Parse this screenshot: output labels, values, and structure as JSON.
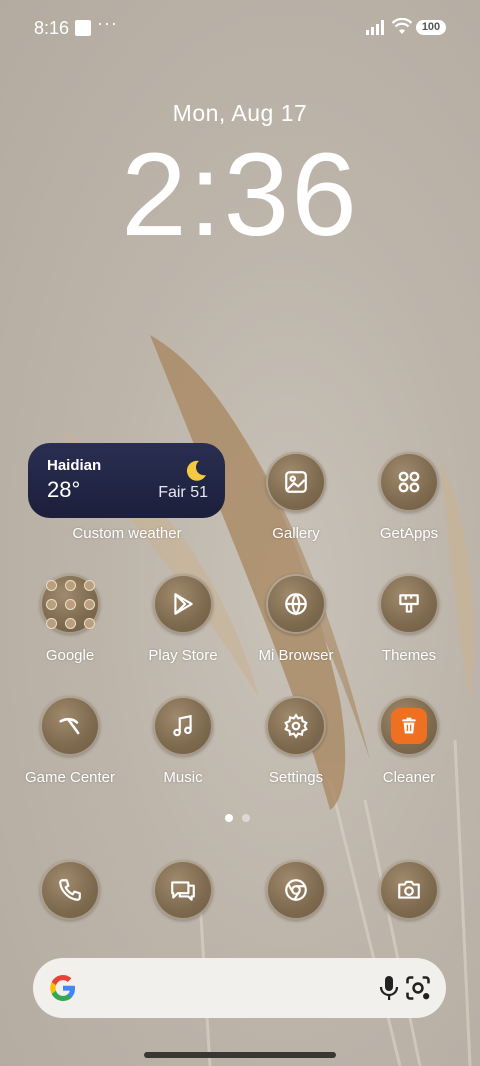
{
  "status_bar": {
    "time": "8:16",
    "dots": "···",
    "battery": "100"
  },
  "lockscreen": {
    "date": "Mon, Aug 17",
    "clock": "2:36"
  },
  "weather_widget": {
    "city": "Haidian",
    "temperature": "28°",
    "condition": "Fair 51",
    "label": "Custom weather"
  },
  "apps": {
    "gallery": "Gallery",
    "getapps": "GetApps",
    "google": "Google",
    "play_store": "Play Store",
    "mi_browser": "Mi Browser",
    "themes": "Themes",
    "game_center": "Game Center",
    "music": "Music",
    "settings": "Settings",
    "cleaner": "Cleaner"
  },
  "dock": [
    "phone-icon",
    "messages-icon",
    "chrome-icon",
    "camera-icon"
  ],
  "pager": {
    "pages": 2,
    "current": 1
  },
  "colors": {
    "icon_bg": "#7e6a4f",
    "weather_bg": "#1b1f3b",
    "cleaner_accent": "#f07022",
    "search_bg": "#f2f0ed"
  }
}
